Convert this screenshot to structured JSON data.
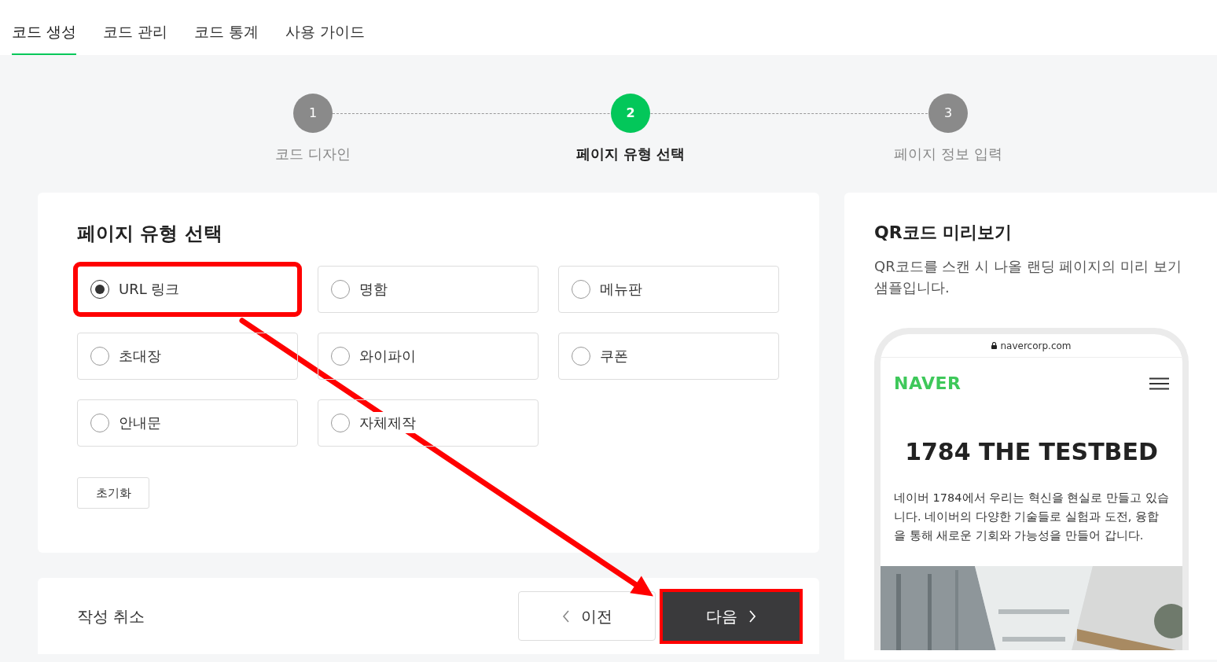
{
  "tabs": [
    {
      "label": "코드 생성",
      "selected": true
    },
    {
      "label": "코드 관리",
      "selected": false
    },
    {
      "label": "코드 통계",
      "selected": false
    },
    {
      "label": "사용 가이드",
      "selected": false
    }
  ],
  "steps": [
    {
      "number": "1",
      "label": "코드 디자인",
      "selected": false
    },
    {
      "number": "2",
      "label": "페이지 유형 선택",
      "selected": true
    },
    {
      "number": "3",
      "label": "페이지 정보 입력",
      "selected": false
    }
  ],
  "page_type": {
    "title": "페이지 유형 선택",
    "options": [
      {
        "label": "URL 링크",
        "selected": true,
        "highlighted": true
      },
      {
        "label": "명함",
        "selected": false,
        "highlighted": false
      },
      {
        "label": "메뉴판",
        "selected": false,
        "highlighted": false
      },
      {
        "label": "초대장",
        "selected": false,
        "highlighted": false
      },
      {
        "label": "와이파이",
        "selected": false,
        "highlighted": false
      },
      {
        "label": "쿠폰",
        "selected": false,
        "highlighted": false
      },
      {
        "label": "안내문",
        "selected": false,
        "highlighted": false
      },
      {
        "label": "자체제작",
        "selected": false,
        "highlighted": false
      }
    ],
    "reset_button": "초기화"
  },
  "footer": {
    "cancel": "작성 취소",
    "prev_button": {
      "label": "이전"
    },
    "next_button": {
      "label": "다음",
      "highlighted": true
    }
  },
  "annotation_arrow": true,
  "preview": {
    "title": "QR코드 미리보기",
    "description": "QR코드를 스캔 시 나올 랜딩 페이지의 미리 보기 샘플입니다.",
    "phone": {
      "url": "navercorp.com",
      "logo": "NAVER",
      "heading": "1784 THE TESTBED",
      "body": "네이버 1784에서 우리는 혁신을 현실로 만들고 있습니다. 네이버의 다양한 기술들로 실험과 도전, 융합을 통해 새로운 기회와 가능성을 만들어 갑니다."
    }
  }
}
